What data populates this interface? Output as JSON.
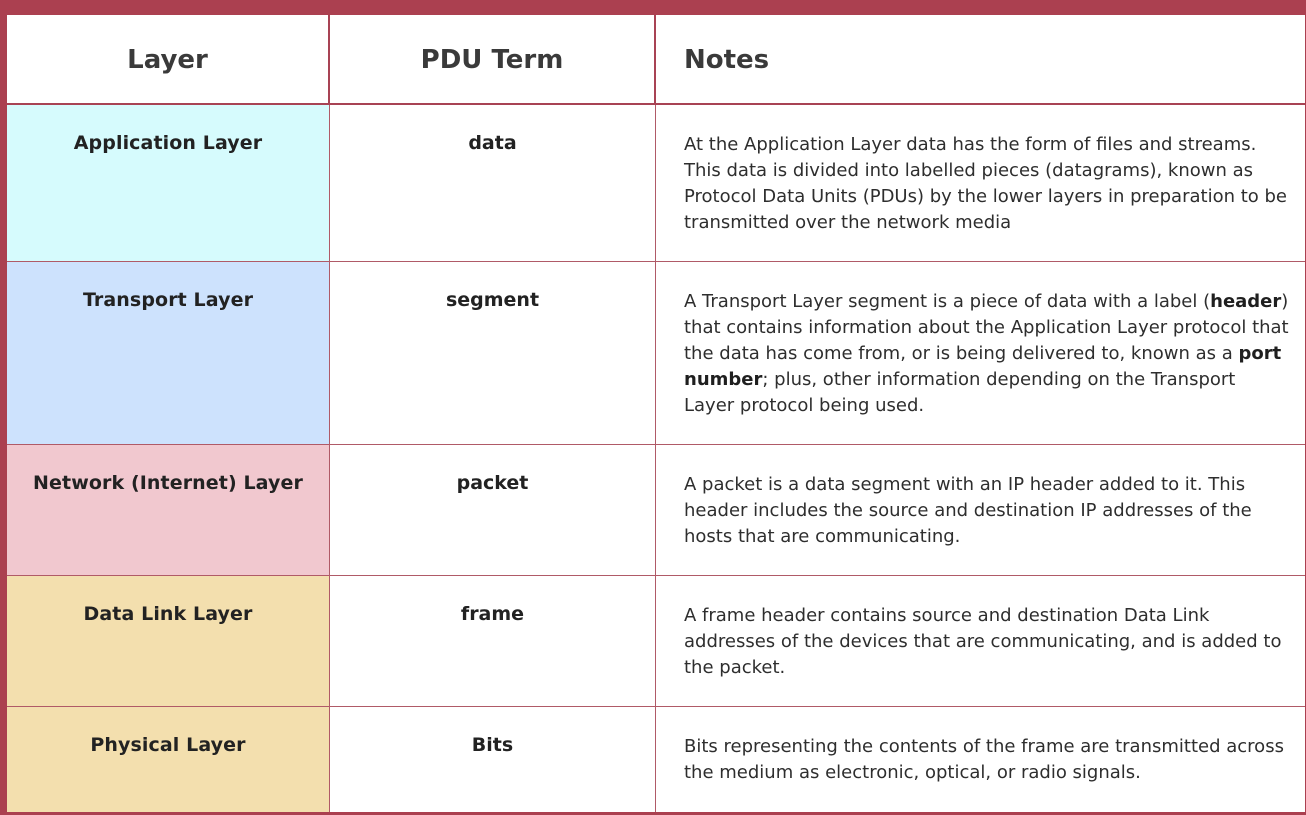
{
  "headers": {
    "layer": "Layer",
    "pdu": "PDU Term",
    "notes": "Notes"
  },
  "rows": [
    {
      "layer": "Application Layer",
      "pdu": "data",
      "notes": "At the Application Layer data has the form of files and streams. This data is divided into labelled pieces (datagrams), known as Protocol Data Units (PDUs) by the lower layers in preparation to be transmitted over the network media",
      "color": "#d6fbfd"
    },
    {
      "layer": "Transport Layer",
      "pdu": "segment",
      "notes_part1": "A Transport Layer segment is a piece of data with a label (",
      "notes_bold1": "header",
      "notes_part2": ") that contains information about the Application Layer protocol that the data has come from, or is being delivered to, known as a ",
      "notes_bold2": "port number",
      "notes_part3": "; plus, other information depending on the Transport Layer protocol being used.",
      "color": "#cde2fd"
    },
    {
      "layer": "Network (Internet) Layer",
      "pdu": "packet",
      "notes": "A packet is a data segment with an IP header added to it. This header includes the source and destination IP addresses of the hosts that are communicating.",
      "color": "#f1c8cf"
    },
    {
      "layer": "Data Link Layer",
      "pdu": "frame",
      "notes": "A frame header contains source and destination Data Link addresses of the devices that are communicating, and is added to the packet.",
      "color": "#f3dfae"
    },
    {
      "layer": "Physical Layer",
      "pdu": "Bits",
      "notes": "Bits representing the contents of the frame are transmitted across the medium as electronic, optical, or radio signals.",
      "color": "#f3dfae"
    }
  ],
  "colors": {
    "border": "#ab4050",
    "grid_line": "#b05a67"
  }
}
